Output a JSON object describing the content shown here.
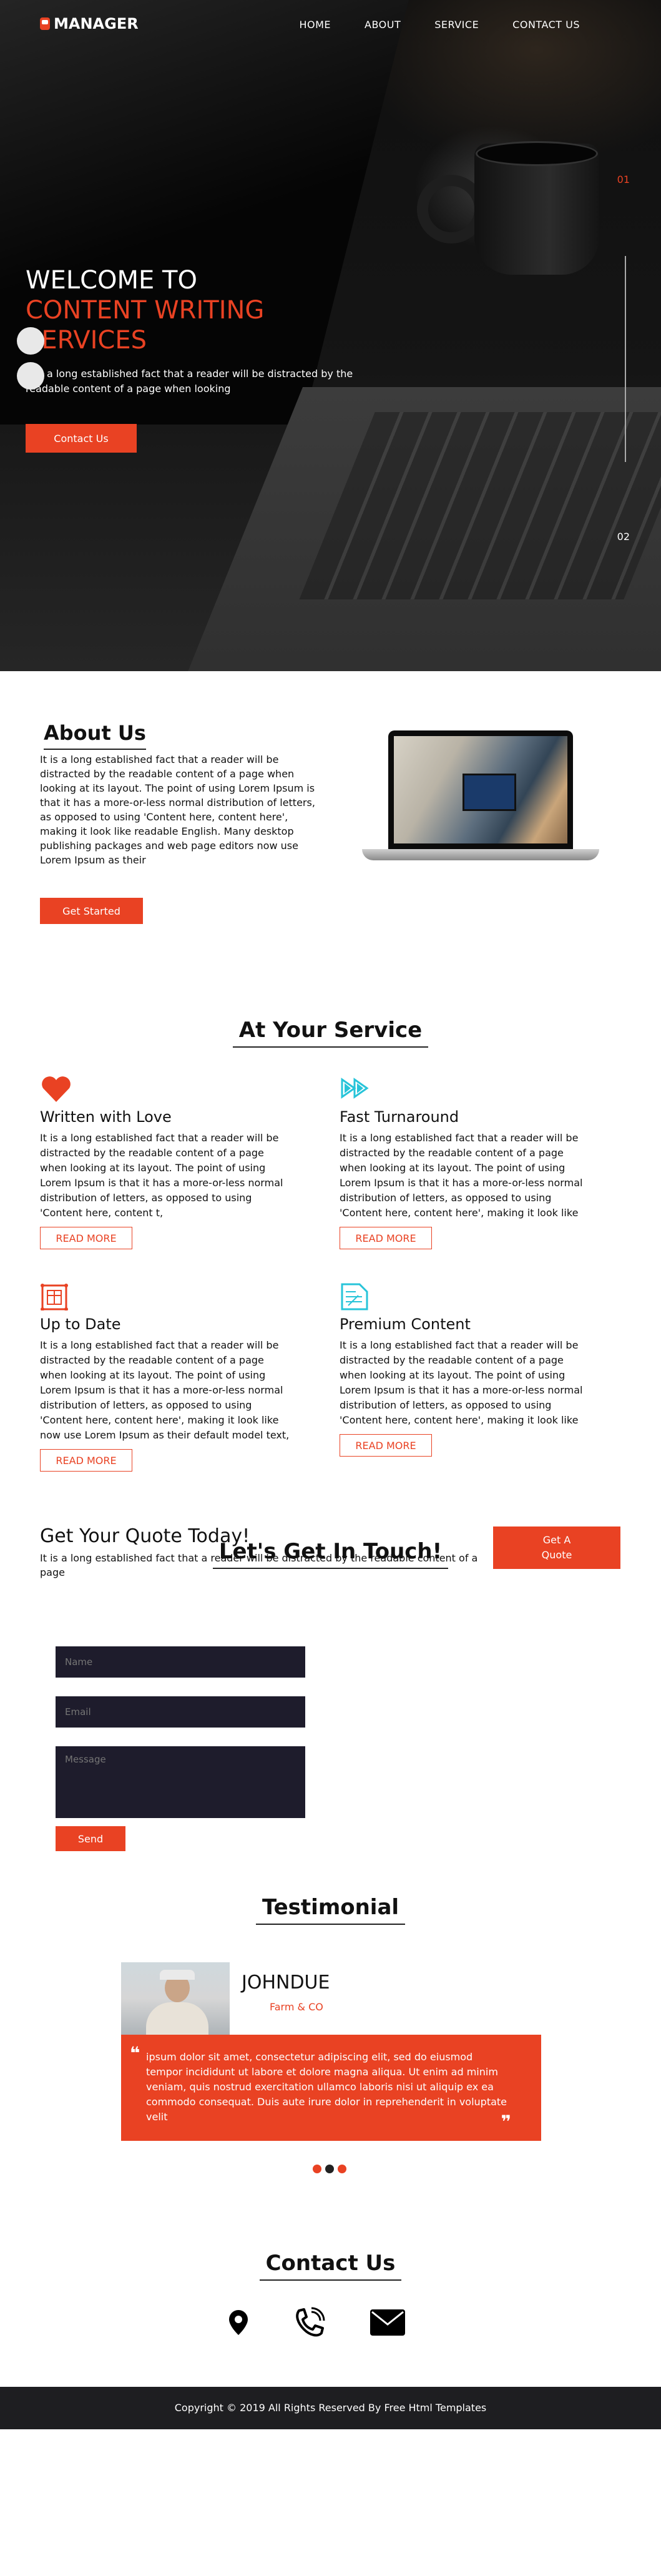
{
  "nav": {
    "logo": "MANAGER",
    "items": [
      "HOME",
      "ABOUT",
      "SERVICE",
      "CONTACT US"
    ]
  },
  "hero": {
    "line1": "WELCOME TO",
    "line2": "CONTENT WRITING",
    "line3": "SERVICES",
    "text": "It is a long established fact that a reader will be distracted by the readable content of a page when looking",
    "button": "Contact Us",
    "slide_current": "01",
    "slide_next": "02"
  },
  "about": {
    "title": "About Us",
    "text": "It is a long established fact that a reader will be distracted by the readable content of a page when looking at its layout. The point of using Lorem Ipsum is that it has a more-or-less normal distribution of letters, as opposed to using 'Content here, content here', making it look like readable English. Many desktop publishing packages and web page editors now use Lorem Ipsum as their",
    "button": "Get Started"
  },
  "services": {
    "title": "At Your Service",
    "read_more": "READ MORE",
    "items": [
      {
        "icon": "heart-icon",
        "title": "Written with Love",
        "text": "It is a long established fact that a reader will be distracted by the readable content of a page when looking at its layout. The point of using Lorem Ipsum is that it has a more-or-less normal distribution of letters, as opposed to using 'Content here, content t,"
      },
      {
        "icon": "fast-forward-icon",
        "title": "Fast Turnaround",
        "text": "It is a long established fact that a reader will be distracted by the readable content of a page when looking at its layout. The point of using Lorem Ipsum is that it has a more-or-less normal distribution of letters, as opposed to using 'Content here, content here', making it look like"
      },
      {
        "icon": "calendar-icon",
        "title": "Up to Date",
        "text": "It is a long established fact that a reader will be distracted by the readable content of a page when looking at its layout. The point of using Lorem Ipsum is that it has a more-or-less normal distribution of letters, as opposed to using 'Content here, content here', making it look like now use Lorem Ipsum as their default model text,"
      },
      {
        "icon": "document-icon",
        "title": "Premium Content",
        "text": "It is a long established fact that a reader will be distracted by the readable content of a page when looking at its layout. The point of using Lorem Ipsum is that it has a more-or-less normal distribution of letters, as opposed to using 'Content here, content here', making it look like"
      }
    ]
  },
  "quote": {
    "title": "Get Your Quote Today!",
    "text": "It is a long established fact that a reader will be distracted by the readable content of a page",
    "button": "Get A Quote"
  },
  "touch": {
    "title": "Let's Get In Touch!",
    "name_placeholder": "Name",
    "email_placeholder": "Email",
    "message_placeholder": "Message",
    "button": "Send"
  },
  "testimonial": {
    "title": "Testimonial",
    "name": "JOHNDUE",
    "role": "Farm & CO",
    "text": "ipsum dolor sit amet, consectetur adipiscing elit, sed do eiusmod tempor incididunt ut labore et dolore magna aliqua. Ut enim ad minim veniam, quis nostrud exercitation ullamco laboris nisi ut aliquip ex ea commodo consequat. Duis aute irure dolor in reprehenderit in voluptate velit"
  },
  "contact": {
    "title": "Contact Us"
  },
  "footer": {
    "text": "Copyright © 2019 All Rights Reserved By Free Html Templates"
  },
  "colors": {
    "accent": "#e94223",
    "service_icon_alt": "#27c4d9",
    "form_field": "#1e1c2c",
    "footer_bg": "#1e1e21"
  }
}
